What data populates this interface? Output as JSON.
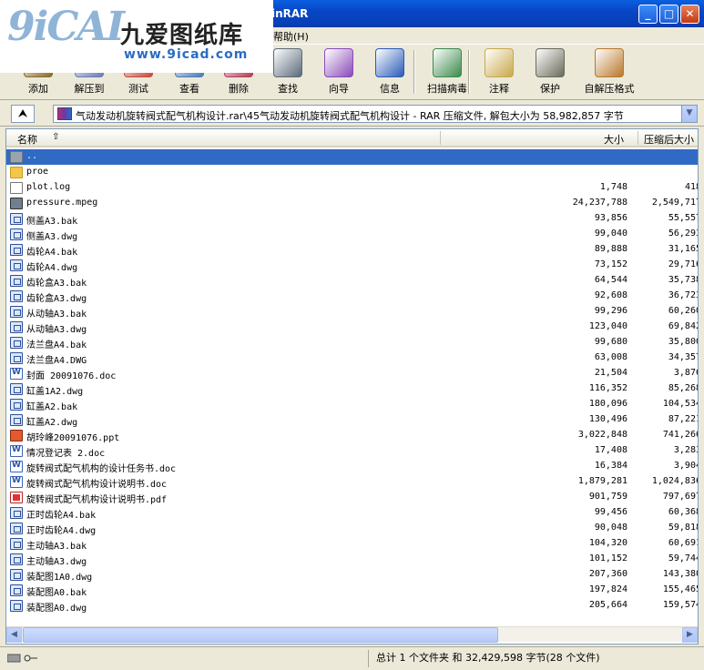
{
  "window": {
    "title": "inRAR"
  },
  "logo": {
    "brand_cn": "九爱图纸库",
    "url": "www.9icad.com",
    "mark": "9iCAI"
  },
  "menu": {
    "help": "帮助(H)"
  },
  "toolbar": [
    {
      "label": "添加",
      "icon": "add-icon",
      "color": "#8a6a2a"
    },
    {
      "label": "解压到",
      "icon": "extract-icon",
      "color": "#6a7ab8"
    },
    {
      "label": "测试",
      "icon": "test-icon",
      "color": "#c84a3a"
    },
    {
      "label": "查看",
      "icon": "view-icon",
      "color": "#4a7ab8"
    },
    {
      "label": "删除",
      "icon": "delete-icon",
      "color": "#b83a5a"
    },
    {
      "label": "查找",
      "icon": "find-icon",
      "color": "#5a6a7a"
    },
    {
      "label": "向导",
      "icon": "wizard-icon",
      "color": "#8a4ab8"
    },
    {
      "label": "信息",
      "icon": "info-icon",
      "color": "#2a5ab8"
    },
    {
      "label": "扫描病毒",
      "icon": "virus-scan-icon",
      "color": "#3a8a4a"
    },
    {
      "label": "注释",
      "icon": "comment-icon",
      "color": "#c8a84a"
    },
    {
      "label": "保护",
      "icon": "protect-icon",
      "color": "#6a6a5a"
    },
    {
      "label": "自解压格式",
      "icon": "sfx-icon",
      "color": "#b8782a"
    }
  ],
  "address": {
    "path": "气动发动机旋转阀式配气机构设计.rar\\45气动发动机旋转阀式配气机构设计 - RAR 压缩文件, 解包大小为 58,982,857 字节"
  },
  "columns": {
    "name": "名称",
    "size": "大小",
    "packed": "压缩后大小"
  },
  "files": [
    {
      "name": "..",
      "size": "",
      "packed": "",
      "type": "up"
    },
    {
      "name": "proe",
      "size": "",
      "packed": "",
      "type": "folder"
    },
    {
      "name": "plot.log",
      "size": "1,748",
      "packed": "418",
      "type": "txt"
    },
    {
      "name": "pressure.mpeg",
      "size": "24,237,788",
      "packed": "2,549,717",
      "type": "mpeg"
    },
    {
      "name": "侧盖A3.bak",
      "size": "93,856",
      "packed": "55,557",
      "type": "cad"
    },
    {
      "name": "侧盖A3.dwg",
      "size": "99,040",
      "packed": "56,293",
      "type": "cad"
    },
    {
      "name": "齿轮A4.bak",
      "size": "89,888",
      "packed": "31,165",
      "type": "cad"
    },
    {
      "name": "齿轮A4.dwg",
      "size": "73,152",
      "packed": "29,716",
      "type": "cad"
    },
    {
      "name": "齿轮盒A3.bak",
      "size": "64,544",
      "packed": "35,738",
      "type": "cad"
    },
    {
      "name": "齿轮盒A3.dwg",
      "size": "92,608",
      "packed": "36,723",
      "type": "cad"
    },
    {
      "name": "从动轴A3.bak",
      "size": "99,296",
      "packed": "60,260",
      "type": "cad"
    },
    {
      "name": "从动轴A3.dwg",
      "size": "123,040",
      "packed": "69,842",
      "type": "cad"
    },
    {
      "name": "法兰盘A4.bak",
      "size": "99,680",
      "packed": "35,800",
      "type": "cad"
    },
    {
      "name": "法兰盘A4.DWG",
      "size": "63,008",
      "packed": "34,357",
      "type": "cad"
    },
    {
      "name": "封面  20091076.doc",
      "size": "21,504",
      "packed": "3,876",
      "type": "doc"
    },
    {
      "name": "缸盖1A2.dwg",
      "size": "116,352",
      "packed": "85,268",
      "type": "cad"
    },
    {
      "name": "缸盖A2.bak",
      "size": "180,096",
      "packed": "104,534",
      "type": "cad"
    },
    {
      "name": "缸盖A2.dwg",
      "size": "130,496",
      "packed": "87,221",
      "type": "cad"
    },
    {
      "name": "胡玲峰20091076.ppt",
      "size": "3,022,848",
      "packed": "741,266",
      "type": "ppt"
    },
    {
      "name": "情况登记表 2.doc",
      "size": "17,408",
      "packed": "3,283",
      "type": "doc"
    },
    {
      "name": "旋转阀式配气机构的设计任务书.doc",
      "size": "16,384",
      "packed": "3,904",
      "type": "doc"
    },
    {
      "name": "旋转阀式配气机构设计说明书.doc",
      "size": "1,879,281",
      "packed": "1,024,836",
      "type": "doc"
    },
    {
      "name": "旋转阀式配气机构设计说明书.pdf",
      "size": "901,759",
      "packed": "797,697",
      "type": "pdf"
    },
    {
      "name": "正时齿轮A4.bak",
      "size": "99,456",
      "packed": "60,368",
      "type": "cad"
    },
    {
      "name": "正时齿轮A4.dwg",
      "size": "90,048",
      "packed": "59,818",
      "type": "cad"
    },
    {
      "name": "主动轴A3.bak",
      "size": "104,320",
      "packed": "60,691",
      "type": "cad"
    },
    {
      "name": "主动轴A3.dwg",
      "size": "101,152",
      "packed": "59,744",
      "type": "cad"
    },
    {
      "name": "装配图1A0.dwg",
      "size": "207,360",
      "packed": "143,380",
      "type": "cad"
    },
    {
      "name": "装配图A0.bak",
      "size": "197,824",
      "packed": "155,465",
      "type": "cad"
    },
    {
      "name": "装配图A0.dwg",
      "size": "205,664",
      "packed": "159,574",
      "type": "cad"
    }
  ],
  "status": {
    "summary": "总计 1 个文件夹 和 32,429,598 字节(28 个文件)"
  }
}
